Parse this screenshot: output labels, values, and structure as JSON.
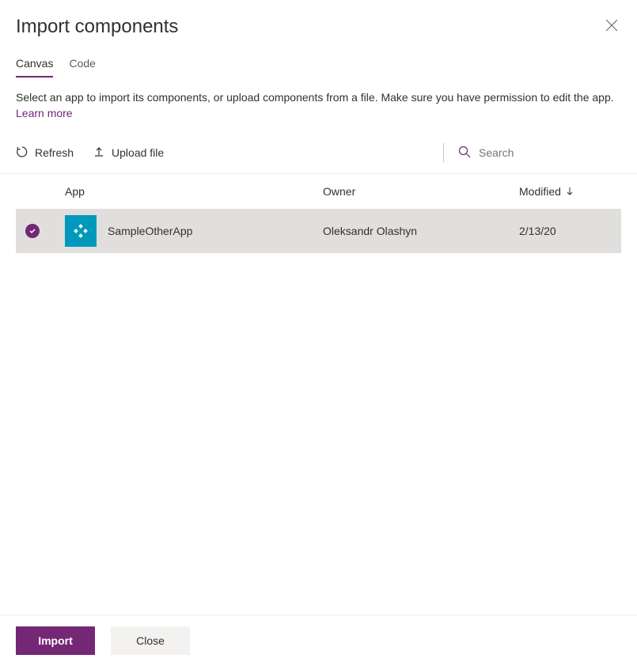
{
  "header": {
    "title": "Import components"
  },
  "tabs": {
    "canvas": "Canvas",
    "code": "Code"
  },
  "description": {
    "text": "Select an app to import its components, or upload components from a file. Make sure you have permission to edit the app. ",
    "learnMore": "Learn more"
  },
  "toolbar": {
    "refresh": "Refresh",
    "uploadFile": "Upload file",
    "searchPlaceholder": "Search"
  },
  "table": {
    "headers": {
      "app": "App",
      "owner": "Owner",
      "modified": "Modified"
    },
    "rows": [
      {
        "app": "SampleOtherApp",
        "owner": "Oleksandr Olashyn",
        "modified": "2/13/20"
      }
    ]
  },
  "footer": {
    "import": "Import",
    "close": "Close"
  }
}
